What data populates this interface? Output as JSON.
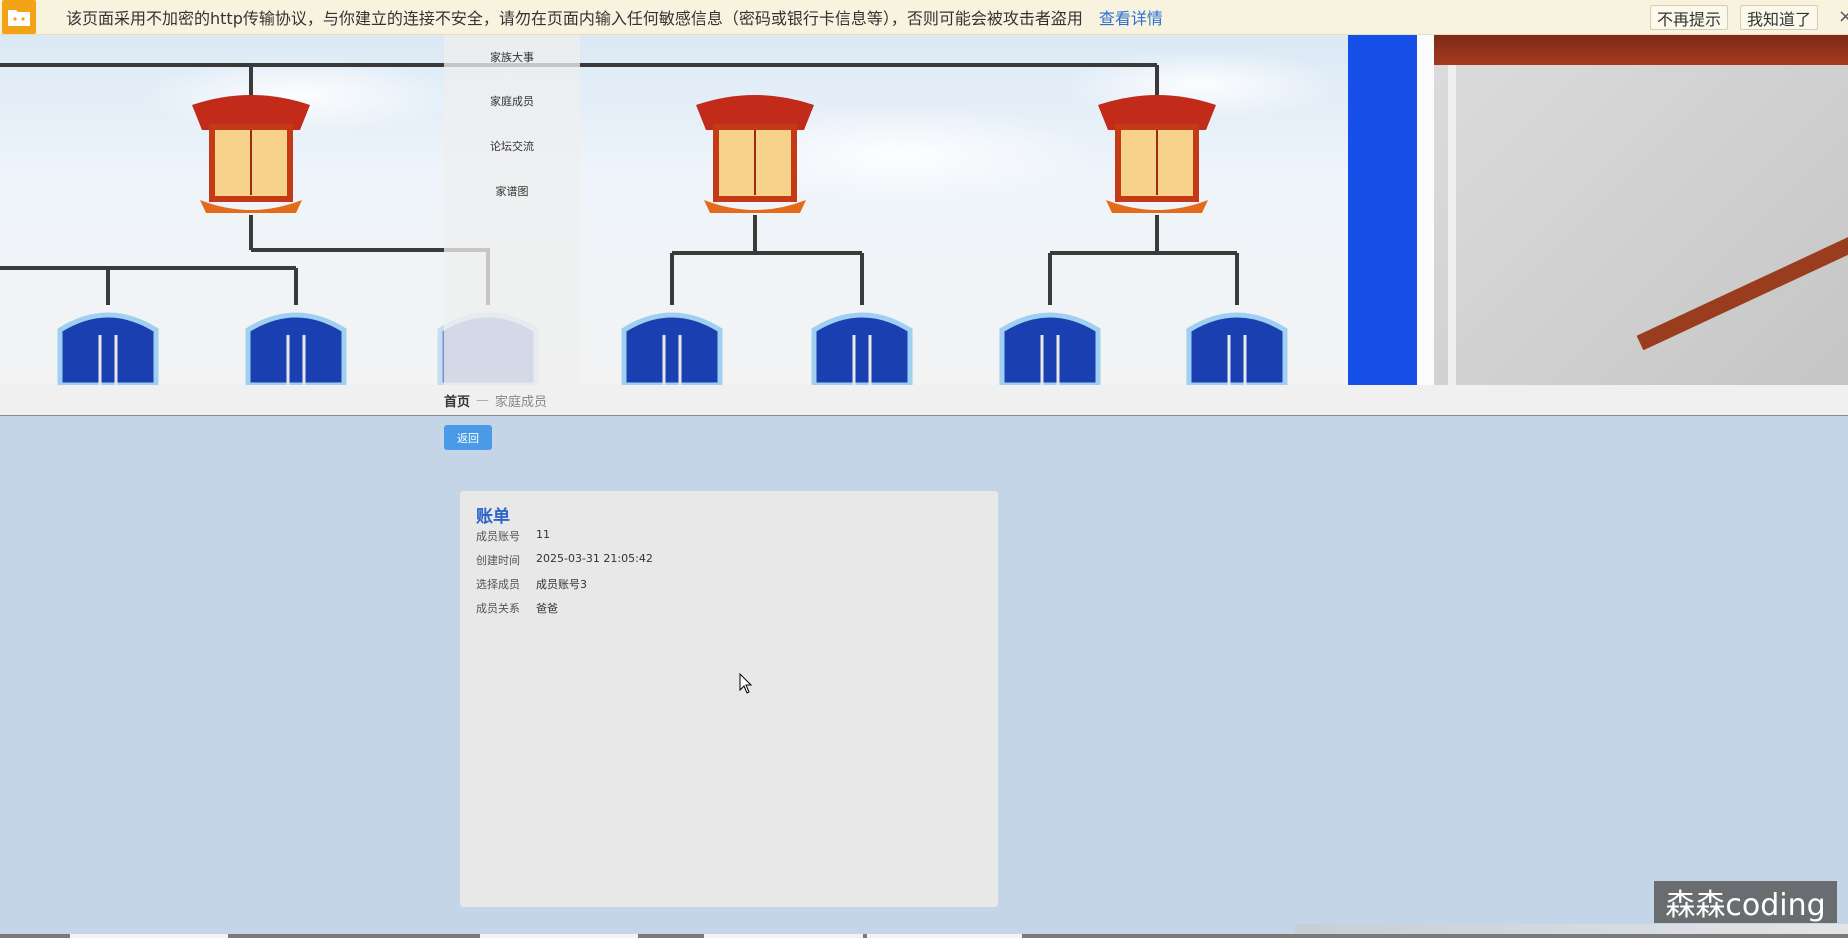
{
  "warning": {
    "text": "该页面采用不加密的http传输协议，与你建立的连接不安全，请勿在页面内输入任何敏感信息（密码或银行卡信息等），否则可能会被攻击者盗用",
    "link": "查看详情",
    "btn_nomore": "不再提示",
    "btn_gotit": "我知道了",
    "close": "×"
  },
  "nav": {
    "items": [
      {
        "label": "家族大事"
      },
      {
        "label": "家庭成员"
      },
      {
        "label": "论坛交流"
      },
      {
        "label": "家谱图"
      }
    ]
  },
  "breadcrumb": {
    "home": "首页",
    "sep": "—",
    "current": "家庭成员"
  },
  "back_button": "返回",
  "card": {
    "title": "账单",
    "rows": [
      {
        "label": "成员账号",
        "value": "11"
      },
      {
        "label": "创建时间",
        "value": "2025-03-31 21:05:42"
      },
      {
        "label": "选择成员",
        "value": "成员账号3"
      },
      {
        "label": "成员关系",
        "value": "爸爸"
      }
    ]
  },
  "watermark": "森森coding",
  "colors": {
    "accent": "#4a9ae8",
    "title": "#2d63c6",
    "page_bg": "#c3d5e6"
  }
}
